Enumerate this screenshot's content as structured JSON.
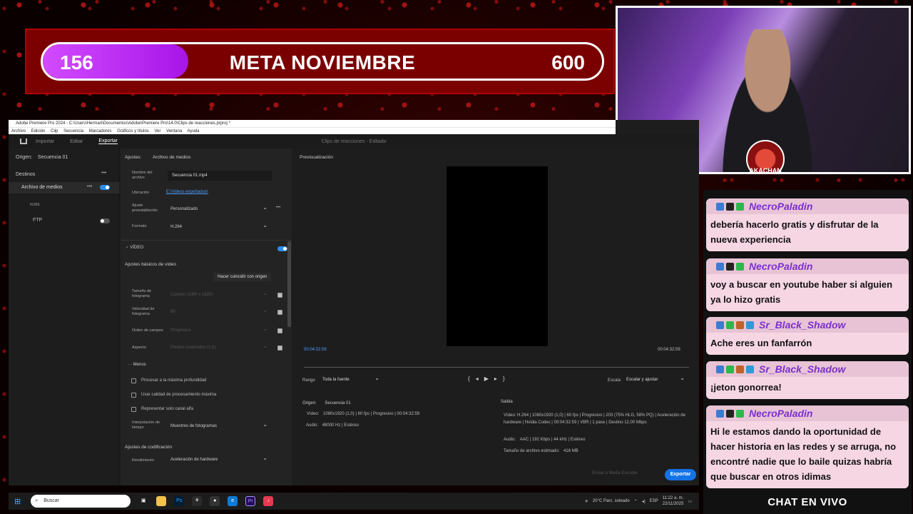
{
  "goal": {
    "current": "156",
    "title": "META NOVIEMBRE",
    "target": "600",
    "progress_fraction": 0.26
  },
  "webcam": {
    "logo_text": "AKACHAN"
  },
  "premiere": {
    "window_title": "Adobe Premiere Pro 2024 - C:\\Users\\Hermari\\Documentos\\Adobe\\Premiere Pro\\14.0\\Clips de reacciones.prproj *",
    "menu": [
      "Archivo",
      "Edición",
      "Clip",
      "Secuencia",
      "Marcadores",
      "Gráficos y títulos",
      "Ver",
      "Ventana",
      "Ayuda"
    ],
    "tabs": [
      "Importar",
      "Editar",
      "Exportar"
    ],
    "active_tab": "Exportar",
    "project_title": "Clips de reacciones - Editado",
    "left": {
      "origin_label": "Origen:",
      "origin_value": "Secuencia 01",
      "destinations_label": "Destinos",
      "media_file": "Archivo de medios",
      "cloud_label": "NUBE",
      "ftp": "FTP"
    },
    "settings": {
      "header_label": "Ajustes:",
      "header_value": "Archivo de medios",
      "filename_label": "Nombre del archivo",
      "filename_value": "Secuencia 01.mp4",
      "location_label": "Ubicación",
      "location_value": "E:\\Videos exportados\\",
      "preset_label": "Ajuste preestablecido",
      "preset_value": "Personalizado",
      "format_label": "Formato",
      "format_value": "H.264",
      "video_section": "VÍDEO",
      "basic_video": "Ajustes básicos de vídeo",
      "match_source": "Hacer coincidir con origen",
      "frame_size_label": "Tamaño de fotograma",
      "frame_size_value": "Custom (1080 x 1920)",
      "frame_rate_label": "Velocidad de fotograma",
      "frame_rate_value": "60",
      "field_order_label": "Orden de campos",
      "field_order_value": "Progresivo",
      "aspect_label": "Aspecto",
      "aspect_value": "Píxeles cuadrados (1,0)",
      "less": "··· Menos",
      "opt1": "Procesar a la máxima profundidad",
      "opt2": "Usar calidad de procesamiento máxima",
      "opt3": "Representar solo canal alfa",
      "interp_label": "Interpolación de tiempo",
      "interp_value": "Muestreo de fotogramas",
      "encode_settings": "Ajustes de codificación",
      "perf_label": "Rendimiento",
      "perf_value": "Aceleración de hardware"
    },
    "preview": {
      "label": "Previsualización",
      "tc_in": "00:04:32:59",
      "tc_out": "00:04:32:59",
      "range_label": "Rango",
      "range_value": "Toda la fuente",
      "scale_label": "Escala",
      "scale_value": "Escalar y ajustar"
    },
    "summary": {
      "origin_label": "Origen:",
      "origin_value": "Secuencia 01",
      "video_label": "Vídeo:",
      "video_value": "1080x1920 (1,0)  |  60 fps  |  Progresivo  |  00:04:32:59",
      "audio_label": "Audio:",
      "audio_value": "48000 Hz  |  Estéreo",
      "output_label": "Salida",
      "out_video_value": "H.264  |  1080x1920 (1,0)  |  60 fps  |  Progresivo  |  203 (75% HLG, 58% PQ)  |  Aceleración de hardware  |  Nvidia Codec  |  00:04:32:59  |  VBR  |  1 pase  |  Destino 12,00 Mbps",
      "out_audio_value": "AAC  |  192 Kbps  |  44 kHz  |  Estéreo",
      "size_label": "Tamaño de archivo estimado:",
      "size_value": "416 MB"
    },
    "send_media": "Enviar a Media Encoder",
    "export_button": "Exportar"
  },
  "taskbar": {
    "search_placeholder": "Buscar",
    "weather": "20°C  Parc. soleado",
    "lang": "ESP",
    "time": "11:22 a. m.",
    "date": "22/11/2025"
  },
  "chat": {
    "messages": [
      {
        "user": "NecroPaladin",
        "text": "debería hacerlo gratis y disfrutar de la nueva experiencia",
        "badges": [
          "#3a7bd5",
          "#222222",
          "#2db84d"
        ]
      },
      {
        "user": "NecroPaladin",
        "text": "voy a buscar en youtube haber si alguien ya lo hizo gratis",
        "badges": [
          "#3a7bd5",
          "#222222",
          "#2db84d"
        ]
      },
      {
        "user": "Sr_Black_Shadow",
        "text": "Ache eres un fanfarrón",
        "badges": [
          "#3a7bd5",
          "#2db84d",
          "#c0622c",
          "#2d9bd5"
        ]
      },
      {
        "user": "Sr_Black_Shadow",
        "text": "¡jeton gonorrea!",
        "badges": [
          "#3a7bd5",
          "#2db84d",
          "#c0622c",
          "#2d9bd5"
        ]
      },
      {
        "user": "NecroPaladin",
        "text": "Hi le estamos dando la oportunidad de hacer historia en las redes y se arruga, no encontré nadie que lo baile quizas habría que buscar en otros idimas",
        "badges": [
          "#3a7bd5",
          "#222222",
          "#2db84d"
        ]
      }
    ],
    "footer": "CHAT EN VIVO"
  }
}
